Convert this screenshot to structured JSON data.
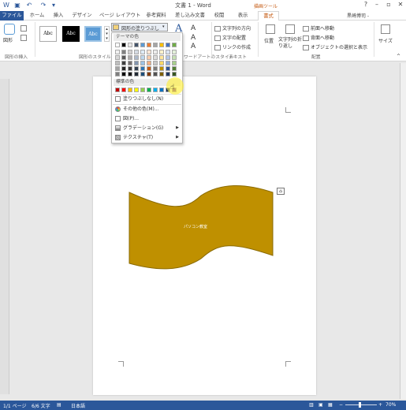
{
  "title": "文書 1 - Word",
  "contextual_tab": "描画ツール",
  "tabs": [
    "ファイル",
    "ホーム",
    "挿入",
    "デザイン",
    "ページ レイアウト",
    "参考資料",
    "差し込み文書",
    "校閲",
    "表示",
    "書式"
  ],
  "user": "黒崎博司 -",
  "ribbon": {
    "groups": {
      "insert_shapes": "図形の挿入",
      "shape_styles": "図形のスタイル",
      "wordart": "ワードアートのスタイル",
      "text": "テキスト",
      "arrange": "配置"
    },
    "shape_btn": "図形",
    "style_thumbs": [
      "Abc",
      "Abc",
      "Abc"
    ],
    "fill_dropdown": "図形の塗りつぶし",
    "text_direction": "文字列の方向",
    "align_text": "文字の配置",
    "create_link": "リンクの作成",
    "position": "位置",
    "wrap_text": "文字列の折り返し",
    "bring_forward": "前面へ移動",
    "send_backward": "背面へ移動",
    "selection_pane": "オブジェクトの選択と表示",
    "size": "サイズ"
  },
  "fill_menu": {
    "theme_colors_header": "テーマの色",
    "standard_colors_header": "標準の色",
    "no_fill": "塗りつぶしなし(N)",
    "more_colors": "その他の色(M)...",
    "picture": "図(P)...",
    "gradient": "グラデーション(G)",
    "texture": "テクスチャ(T)",
    "theme_top_row": [
      "#ffffff",
      "#000000",
      "#e7e6e6",
      "#44546a",
      "#5b9bd5",
      "#ed7d31",
      "#a5a5a5",
      "#ffc000",
      "#4472c4",
      "#70ad47"
    ],
    "theme_shades": [
      [
        "#f2f2f2",
        "#808080",
        "#d0cece",
        "#d6dce4",
        "#deebf6",
        "#fbe5d5",
        "#ededed",
        "#fff2cc",
        "#dae3f3",
        "#e2efd9"
      ],
      [
        "#d8d8d8",
        "#595959",
        "#aeabab",
        "#adb9ca",
        "#bdd7ee",
        "#f7cbac",
        "#dbdbdb",
        "#fee599",
        "#b4c6e7",
        "#c5e0b3"
      ],
      [
        "#bfbfbf",
        "#3f3f3f",
        "#757070",
        "#8496b0",
        "#9dc3e6",
        "#f4b183",
        "#c9c9c9",
        "#ffd965",
        "#8eaadb",
        "#a8d08d"
      ],
      [
        "#a5a5a5",
        "#262626",
        "#3a3838",
        "#323f4f",
        "#2e75b5",
        "#c55a11",
        "#7b7b7b",
        "#bf9000",
        "#2f5496",
        "#538135"
      ],
      [
        "#7f7f7f",
        "#0c0c0c",
        "#171616",
        "#222a35",
        "#1e4e79",
        "#833c0b",
        "#525252",
        "#7f6000",
        "#1f3864",
        "#375623"
      ]
    ],
    "standard_colors": [
      "#c00000",
      "#ff0000",
      "#ffc000",
      "#ffff00",
      "#92d050",
      "#00b050",
      "#00b0f0",
      "#0070c0",
      "#002060",
      "#7030a0"
    ]
  },
  "shape": {
    "text": "パソコン教室",
    "fill": "#bf9000",
    "stroke": "#8a6a00"
  },
  "status": {
    "page": "1/1 ページ",
    "words": "6/6 文字",
    "language": "日本語",
    "zoom": "70%"
  },
  "colors": {
    "accent": "#2b579a",
    "format_tab": "#c55a11"
  }
}
